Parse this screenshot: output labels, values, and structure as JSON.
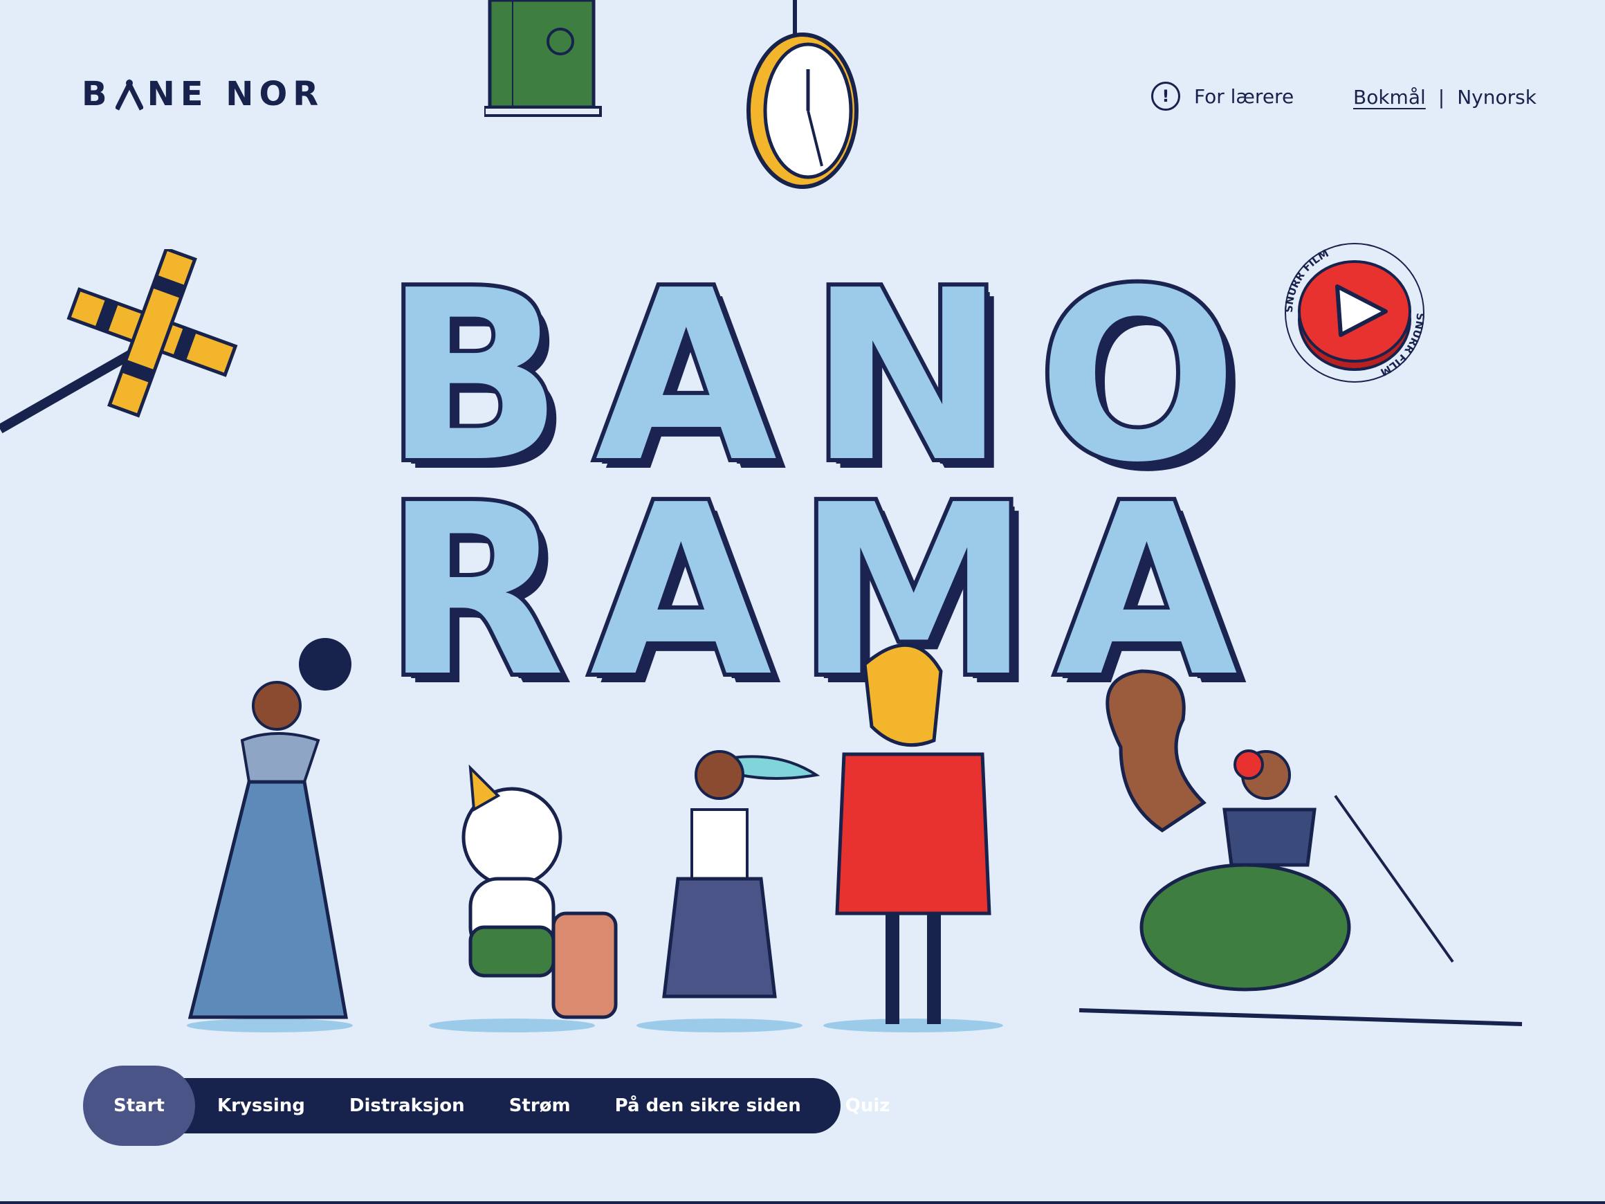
{
  "brand": {
    "logo_text_left": "B",
    "logo_text_right": "NE NOR"
  },
  "header": {
    "teacher_icon": "exclamation-circle-icon",
    "teacher_label": "For lærere",
    "languages": {
      "active": "Bokmål",
      "separator": "|",
      "other": "Nynorsk"
    }
  },
  "hero": {
    "title_line1": [
      "B",
      "A",
      "N",
      "O"
    ],
    "title_line2": [
      "R",
      "A",
      "M",
      "A"
    ],
    "badge_text": "SNURR FILM",
    "badge_icon": "play-icon"
  },
  "nav": {
    "items": [
      {
        "label": "Start",
        "active": true
      },
      {
        "label": "Kryssing",
        "active": false
      },
      {
        "label": "Distraksjon",
        "active": false
      },
      {
        "label": "Strøm",
        "active": false
      },
      {
        "label": "På den sikre siden",
        "active": false
      },
      {
        "label": "Quiz",
        "active": false
      }
    ]
  },
  "colors": {
    "background": "#e3edfa",
    "navy": "#17224d",
    "light_blue": "#9ccbe9",
    "red": "#e8322f",
    "yellow": "#f3b52c",
    "green": "#3e7f41"
  }
}
